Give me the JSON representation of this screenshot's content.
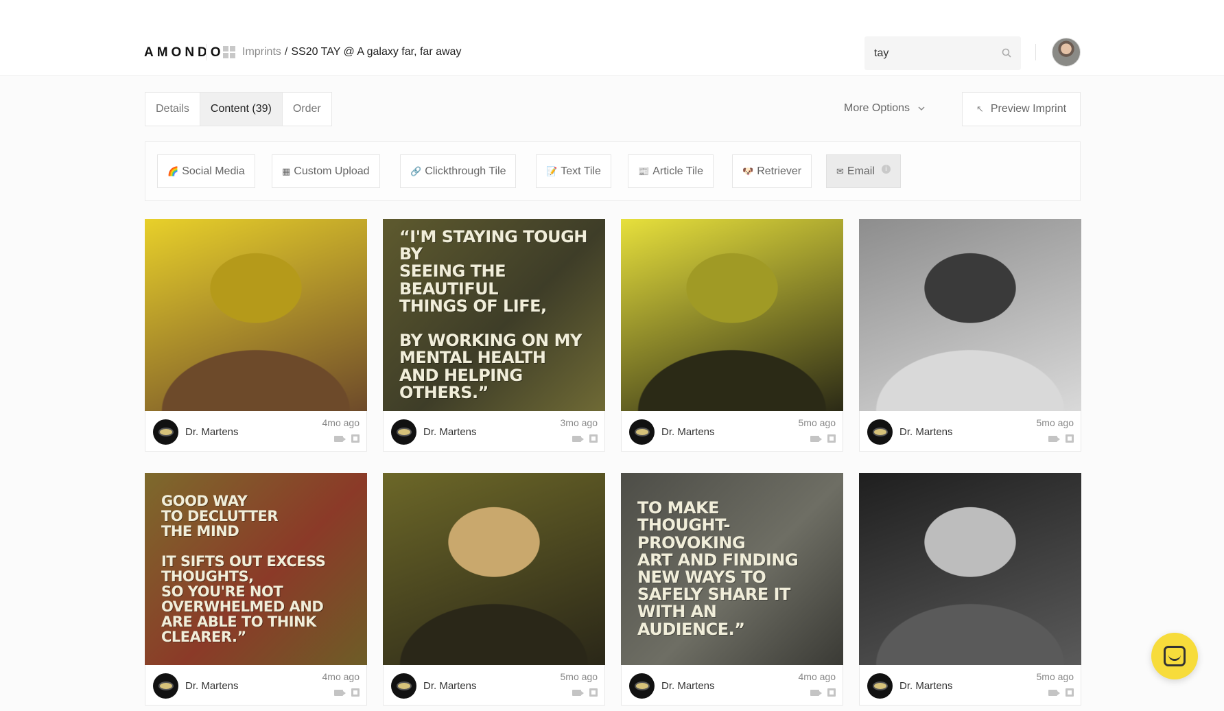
{
  "header": {
    "logo": "AMONDO",
    "breadcrumb_link": "Imprints",
    "breadcrumb_separator": "/",
    "breadcrumb_current": "SS20 TAY @ A galaxy far, far away",
    "search_value": "tay"
  },
  "tabs": [
    {
      "label": "Details",
      "active": false
    },
    {
      "label": "Content (39)",
      "active": true
    },
    {
      "label": "Order",
      "active": false
    }
  ],
  "actions": {
    "more_options": "More Options",
    "preview": "Preview Imprint"
  },
  "toolbar": [
    {
      "label": "Social Media",
      "icon": "rainbow-icon"
    },
    {
      "label": "Custom Upload",
      "icon": "grid-icon"
    },
    {
      "label": "Clickthrough Tile",
      "icon": "link-icon"
    },
    {
      "label": "Text Tile",
      "icon": "memo-icon"
    },
    {
      "label": "Article Tile",
      "icon": "newspaper-icon"
    },
    {
      "label": "Retriever",
      "icon": "dog-icon"
    },
    {
      "label": "Email",
      "icon": "email-icon"
    }
  ],
  "cards": [
    {
      "brand": "Dr. Martens",
      "time": "4mo ago",
      "kind": "photo",
      "palette": [
        "#e8d02a",
        "#b59a1a",
        "#6d4a2a"
      ]
    },
    {
      "brand": "Dr. Martens",
      "time": "3mo ago",
      "kind": "quote",
      "quote": "“I'M STAYING TOUGH BY\nSEEING THE BEAUTIFUL\nTHINGS OF LIFE,\n\nBY WORKING ON MY\nMENTAL HEALTH\nAND HELPING OTHERS.”",
      "palette": [
        "#5e5a2e",
        "#3e3d28",
        "#6f6a35"
      ]
    },
    {
      "brand": "Dr. Martens",
      "time": "5mo ago",
      "kind": "photo",
      "palette": [
        "#e7e03c",
        "#a09a25",
        "#2b2a16"
      ]
    },
    {
      "brand": "Dr. Martens",
      "time": "5mo ago",
      "kind": "photo",
      "palette": [
        "#8d8d8d",
        "#3a3a3a",
        "#d9d9d9"
      ]
    },
    {
      "brand": "Dr. Martens",
      "time": "4mo ago",
      "kind": "quote",
      "quote": "GOOD WAY\nTO DECLUTTER\nTHE MIND\n\nIT SIFTS OUT EXCESS THOUGHTS,\nSO YOU'RE NOT\nOVERWHELMED AND\nARE ABLE TO THINK CLEARER.”",
      "palette": [
        "#7d6a2c",
        "#8b3a28",
        "#6d5d27"
      ]
    },
    {
      "brand": "Dr. Martens",
      "time": "5mo ago",
      "kind": "photo",
      "palette": [
        "#6c6728",
        "#c9a86d",
        "#2a2718"
      ]
    },
    {
      "brand": "Dr. Martens",
      "time": "4mo ago",
      "kind": "quote",
      "quote": "TO MAKE\nTHOUGHT-PROVOKING\nART AND FINDING\nNEW WAYS TO\nSAFELY SHARE IT\nWITH AN AUDIENCE.”",
      "palette": [
        "#4d4d47",
        "#6e6e64",
        "#3a3a35"
      ]
    },
    {
      "brand": "Dr. Martens",
      "time": "5mo ago",
      "kind": "photo",
      "palette": [
        "#1f1f1f",
        "#bdbdbd",
        "#5a5a5a"
      ]
    }
  ],
  "card_icons": [
    "video-icon",
    "bookmark-icon"
  ],
  "colors": {
    "accent_yellow": "#f7dc3b",
    "background": "#fbfbfb"
  }
}
